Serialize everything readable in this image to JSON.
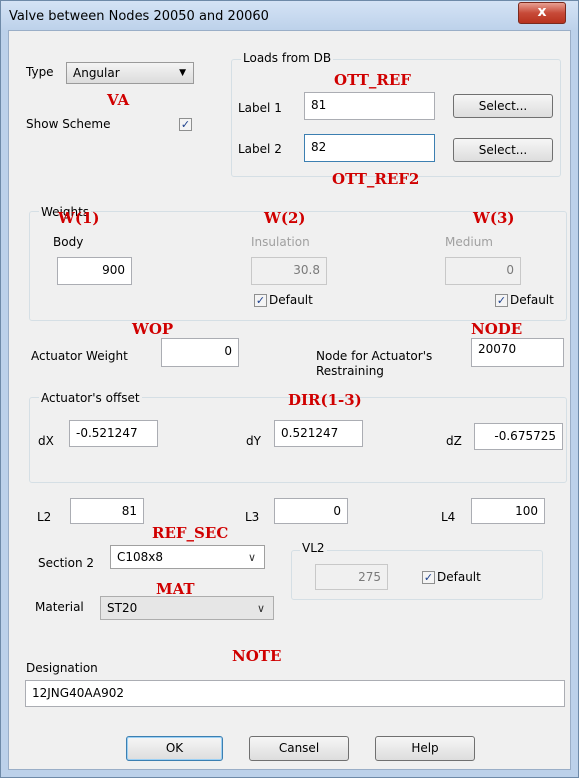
{
  "window": {
    "title": "Valve between Nodes 20050 and 20060",
    "close_glyph": "x"
  },
  "type": {
    "label": "Type",
    "value": "Angular"
  },
  "show_scheme": {
    "label": "Show Scheme",
    "checked": true
  },
  "loads_from_db": {
    "title": "Loads from DB",
    "label1": {
      "label": "Label 1",
      "value": "81",
      "button": "Select..."
    },
    "label2": {
      "label": "Label 2",
      "value": "82",
      "button": "Select..."
    }
  },
  "weights": {
    "title": "Weights",
    "body": {
      "label": "Body",
      "value": "900"
    },
    "insulation": {
      "label": "Insulation",
      "value": "30.8",
      "default_label": "Default",
      "default_checked": true
    },
    "medium": {
      "label": "Medium",
      "value": "0",
      "default_label": "Default",
      "default_checked": true
    }
  },
  "actuator_weight": {
    "label": "Actuator Weight",
    "value": "0"
  },
  "node_restraining": {
    "label_line1": "Node for Actuator's",
    "label_line2": "Restraining",
    "value": "20070"
  },
  "actuator_offset": {
    "title": "Actuator's offset",
    "dx": {
      "label": "dX",
      "value": "-0.521247"
    },
    "dy": {
      "label": "dY",
      "value": "0.521247"
    },
    "dz": {
      "label": "dZ",
      "value": "-0.675725"
    }
  },
  "l2": {
    "label": "L2",
    "value": "81"
  },
  "l3": {
    "label": "L3",
    "value": "0"
  },
  "l4": {
    "label": "L4",
    "value": "100"
  },
  "section2": {
    "label": "Section 2",
    "value": "C108x8"
  },
  "vl2": {
    "title": "VL2",
    "value": "275",
    "default_label": "Default",
    "default_checked": true
  },
  "material": {
    "label": "Material",
    "value": "ST20"
  },
  "designation": {
    "label": "Designation",
    "value": "12JNG40AA902"
  },
  "buttons": {
    "ok": "OK",
    "cancel": "Cansel",
    "help": "Help"
  },
  "annotations": {
    "va": "VA",
    "ott_ref": "OTT_REF",
    "ott_ref2": "OTT_REF2",
    "w1": "W(1)",
    "w2": "W(2)",
    "w3": "W(3)",
    "wop": "WOP",
    "node": "NODE",
    "dir": "DIR(1-3)",
    "ref_sec": "REF_SEC",
    "mat": "MAT",
    "note": "NOTE"
  },
  "colors": {
    "annotation": "#d00000",
    "titlebar": "#bcd1ea",
    "client_bg": "#f0f0f0",
    "close": "#c74a38"
  }
}
